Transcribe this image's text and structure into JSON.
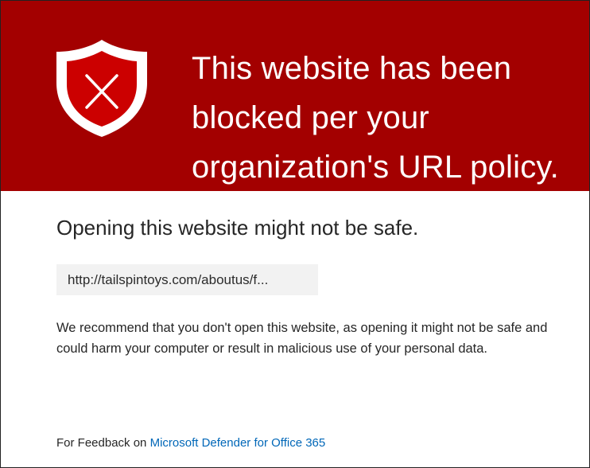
{
  "colors": {
    "banner": "#a30000",
    "banner_text": "#ffffff",
    "link": "#0067b8",
    "url_box_bg": "#f2f2f2"
  },
  "banner": {
    "icon": "shield-x-icon",
    "headline": "This website has been blocked per your organization's URL policy."
  },
  "main": {
    "subheading": "Opening this website might not be safe.",
    "url": "http://tailspintoys.com/aboutus/f...",
    "description": "We recommend that you don't open this website, as opening it might not be safe and could harm your computer or result in malicious use of your personal data."
  },
  "footer": {
    "feedback_prefix": "For Feedback on",
    "feedback_link": "Microsoft Defender for Office 365"
  }
}
